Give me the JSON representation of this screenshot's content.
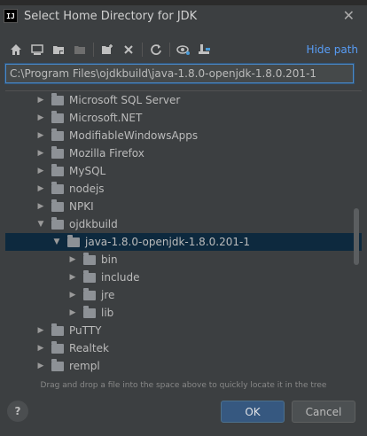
{
  "window": {
    "title": "Select Home Directory for JDK",
    "app_icon_text": "IJ"
  },
  "toolbar": {
    "icons": [
      "home-icon",
      "desktop-icon",
      "project-folder-icon",
      "module-folder-icon",
      "new-folder-icon",
      "delete-icon",
      "refresh-icon",
      "show-hidden-icon",
      "drag-drop-icon"
    ],
    "hide_path_label": "Hide path"
  },
  "path_field": {
    "value": "C:\\Program Files\\ojdkbuild\\java-1.8.0-openjdk-1.8.0.201-1"
  },
  "tree": {
    "items": [
      {
        "label": "Microsoft SQL Server",
        "level": 1,
        "expanded": false,
        "selected": false
      },
      {
        "label": "Microsoft.NET",
        "level": 1,
        "expanded": false,
        "selected": false
      },
      {
        "label": "ModifiableWindowsApps",
        "level": 1,
        "expanded": false,
        "selected": false
      },
      {
        "label": "Mozilla Firefox",
        "level": 1,
        "expanded": false,
        "selected": false
      },
      {
        "label": "MySQL",
        "level": 1,
        "expanded": false,
        "selected": false
      },
      {
        "label": "nodejs",
        "level": 1,
        "expanded": false,
        "selected": false
      },
      {
        "label": "NPKI",
        "level": 1,
        "expanded": false,
        "selected": false
      },
      {
        "label": "ojdkbuild",
        "level": 1,
        "expanded": true,
        "selected": false
      },
      {
        "label": "java-1.8.0-openjdk-1.8.0.201-1",
        "level": 2,
        "expanded": true,
        "selected": true
      },
      {
        "label": "bin",
        "level": 3,
        "expanded": false,
        "selected": false
      },
      {
        "label": "include",
        "level": 3,
        "expanded": false,
        "selected": false
      },
      {
        "label": "jre",
        "level": 3,
        "expanded": false,
        "selected": false
      },
      {
        "label": "lib",
        "level": 3,
        "expanded": false,
        "selected": false
      },
      {
        "label": "PuTTY",
        "level": 1,
        "expanded": false,
        "selected": false
      },
      {
        "label": "Realtek",
        "level": 1,
        "expanded": false,
        "selected": false
      },
      {
        "label": "rempl",
        "level": 1,
        "expanded": false,
        "selected": false
      }
    ]
  },
  "hint_text": "Drag and drop a file into the space above to quickly locate it in the tree",
  "buttons": {
    "help": "?",
    "ok": "OK",
    "cancel": "Cancel"
  }
}
